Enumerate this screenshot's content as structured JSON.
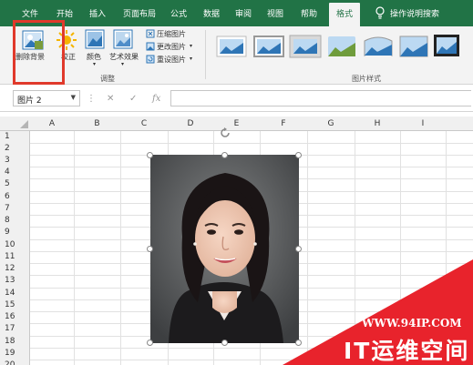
{
  "tabs": [
    "文件",
    "开始",
    "插入",
    "页面布局",
    "公式",
    "数据",
    "审阅",
    "视图",
    "帮助",
    "格式"
  ],
  "tell_me": "操作说明搜索",
  "ribbon": {
    "remove_bg": "删除背景",
    "correct": "校正",
    "color": "颜色",
    "art_effects": "艺术效果",
    "compress": "压缩图片",
    "change": "更改图片",
    "reset": "重设图片",
    "adjust_group": "调整",
    "styles_group": "图片样式"
  },
  "formula_bar": {
    "name_box": "图片 2",
    "fx": "fx"
  },
  "columns": [
    "A",
    "B",
    "C",
    "D",
    "E",
    "F",
    "G",
    "H",
    "I"
  ],
  "rows": [
    "1",
    "2",
    "3",
    "4",
    "5",
    "6",
    "7",
    "8",
    "9",
    "10",
    "11",
    "12",
    "13",
    "14",
    "15",
    "16",
    "17",
    "18",
    "19",
    "20"
  ],
  "watermark": {
    "url": "WWW.94IP.COM",
    "brand": "IT运维空间"
  },
  "colors": {
    "accent": "#217346",
    "highlight_box": "#e0392b",
    "watermark": "#e8232c"
  }
}
